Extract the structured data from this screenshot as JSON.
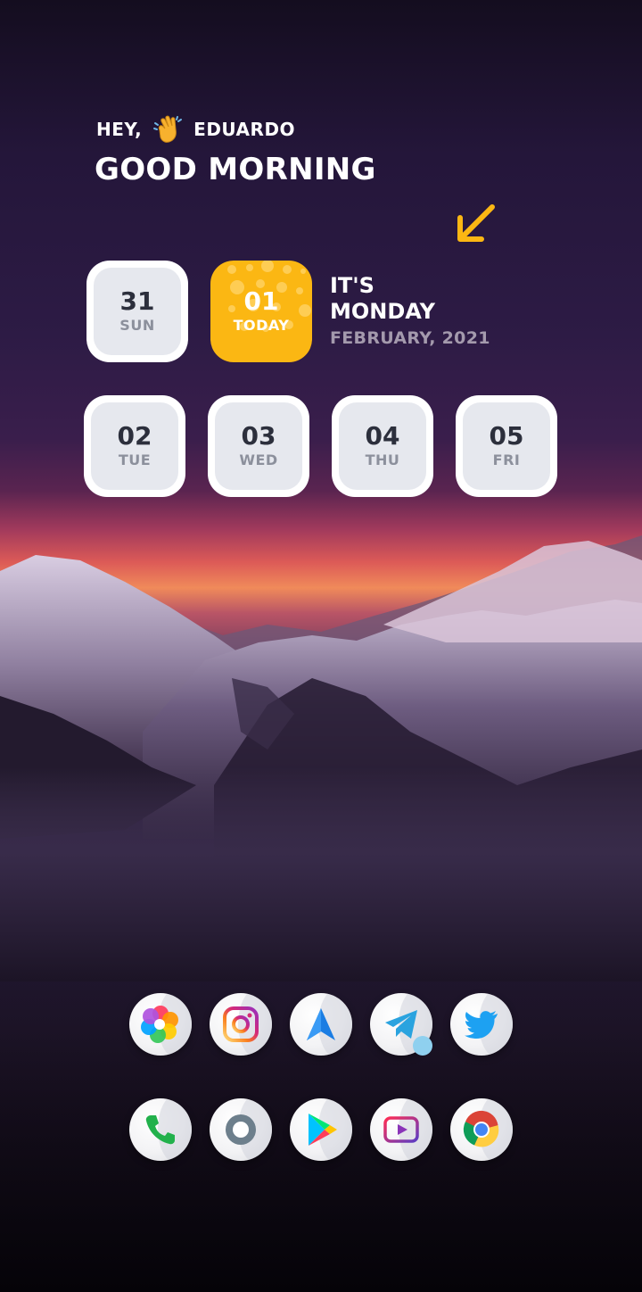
{
  "greeting": {
    "hey": "HEY,",
    "name": "EDUARDO",
    "message": "GOOD MORNING"
  },
  "calendar": {
    "previous": {
      "num": "31",
      "day": "SUN"
    },
    "today": {
      "num": "01",
      "day": "TODAY"
    },
    "its_label": "IT'S",
    "weekday": "MONDAY",
    "month_year": "FEBRUARY, 2021",
    "upcoming": [
      {
        "num": "02",
        "day": "TUE"
      },
      {
        "num": "03",
        "day": "WED"
      },
      {
        "num": "04",
        "day": "THU"
      },
      {
        "num": "05",
        "day": "FRI"
      }
    ]
  },
  "dock": {
    "row1": [
      "gallery-icon",
      "instagram-icon",
      "spark-mail-icon",
      "telegram-icon",
      "twitter-icon"
    ],
    "row2": [
      "phone-icon",
      "camera-icon",
      "play-store-icon",
      "youtube-icon",
      "chrome-icon"
    ]
  },
  "colors": {
    "accent": "#fbb713",
    "tile_bg": "#ffffff",
    "tile_inner": "#e6e8ee",
    "notification": "#8fd0ef"
  }
}
